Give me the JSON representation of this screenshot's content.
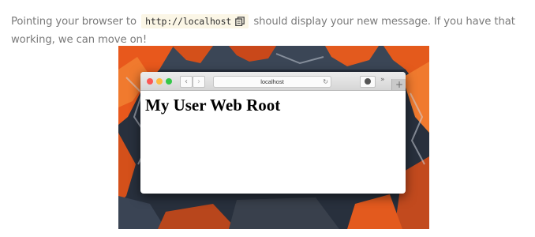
{
  "paragraph": {
    "text_before": "Pointing your browser to",
    "code": "http://localhost",
    "text_after": "should display your new message. If you have that working, we can move on!"
  },
  "icons": {
    "copy": "copy-icon",
    "reload": "reload-icon",
    "download": "download-icon",
    "more": "chevron-double-right-icon",
    "new_tab": "plus-icon",
    "back": "chevron-left-icon",
    "forward": "chevron-right-icon"
  },
  "browser": {
    "url": "localhost",
    "page_heading": "My User Web Root",
    "traffic_lights": {
      "close": "#fc5753",
      "minimize": "#fdbc40",
      "zoom": "#33c748"
    }
  },
  "colors": {
    "paragraph_text": "#7a7a7a",
    "code_background": "#fbf6e6",
    "wallpaper_dark": "#2b3341",
    "wallpaper_orange": "#e8581c"
  }
}
